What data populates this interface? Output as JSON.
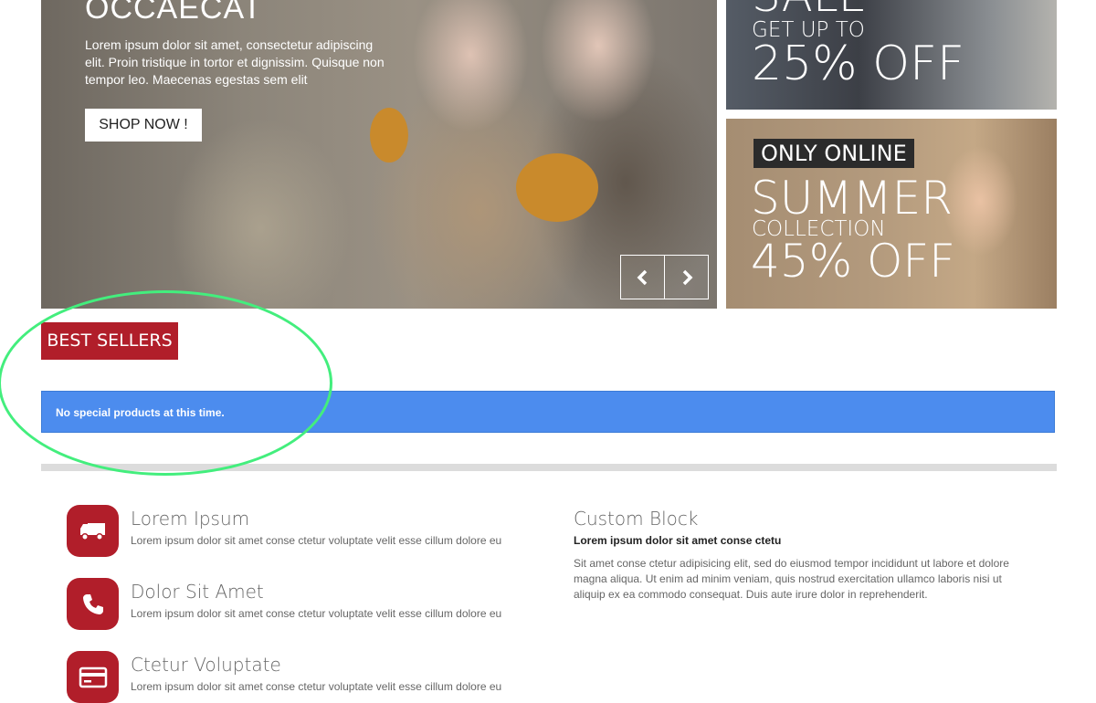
{
  "slider": {
    "title": "OCCAECAT",
    "text": "Lorem ipsum dolor sit amet, consectetur adipiscing elit. Proin tristique in tortor et dignissim. Quisque non tempor leo. Maecenas egestas sem elit",
    "button_label": "SHOP NOW !",
    "prev_icon": "chevron-left-icon",
    "next_icon": "chevron-right-icon"
  },
  "banner_sale": {
    "heading": "SALE",
    "line1": "GET UP TO",
    "line2": "25% OFF"
  },
  "banner_summer": {
    "badge": "ONLY ONLINE",
    "line1": "SUMMER",
    "line2": "COLLECTION",
    "line3": "45% OFF"
  },
  "best_sellers": {
    "title": "BEST SELLERS",
    "message": "No special products at this time."
  },
  "features": [
    {
      "icon": "truck-icon",
      "title": "Lorem Ipsum",
      "text": "Lorem ipsum dolor sit amet conse ctetur voluptate velit esse cillum dolore eu"
    },
    {
      "icon": "phone-icon",
      "title": "Dolor Sit Amet",
      "text": "Lorem ipsum dolor sit amet conse ctetur voluptate velit esse cillum dolore eu"
    },
    {
      "icon": "credit-card-icon",
      "title": "Ctetur Voluptate",
      "text": "Lorem ipsum dolor sit amet conse ctetur voluptate velit esse cillum dolore eu"
    }
  ],
  "custom_block": {
    "title": "Custom Block",
    "subtitle": "Lorem ipsum dolor sit amet conse ctetu",
    "text": "Sit amet conse ctetur adipisicing elit, sed do eiusmod tempor incididunt ut labore et dolore magna aliqua. Ut enim ad minim veniam, quis nostrud exercitation ullamco laboris nisi ut aliquip ex ea commodo consequat. Duis aute irure dolor in reprehenderit."
  },
  "colors": {
    "accent_red": "#b11e2a",
    "alert_blue": "#4c8cee",
    "annotation_green": "#43ee7d"
  }
}
